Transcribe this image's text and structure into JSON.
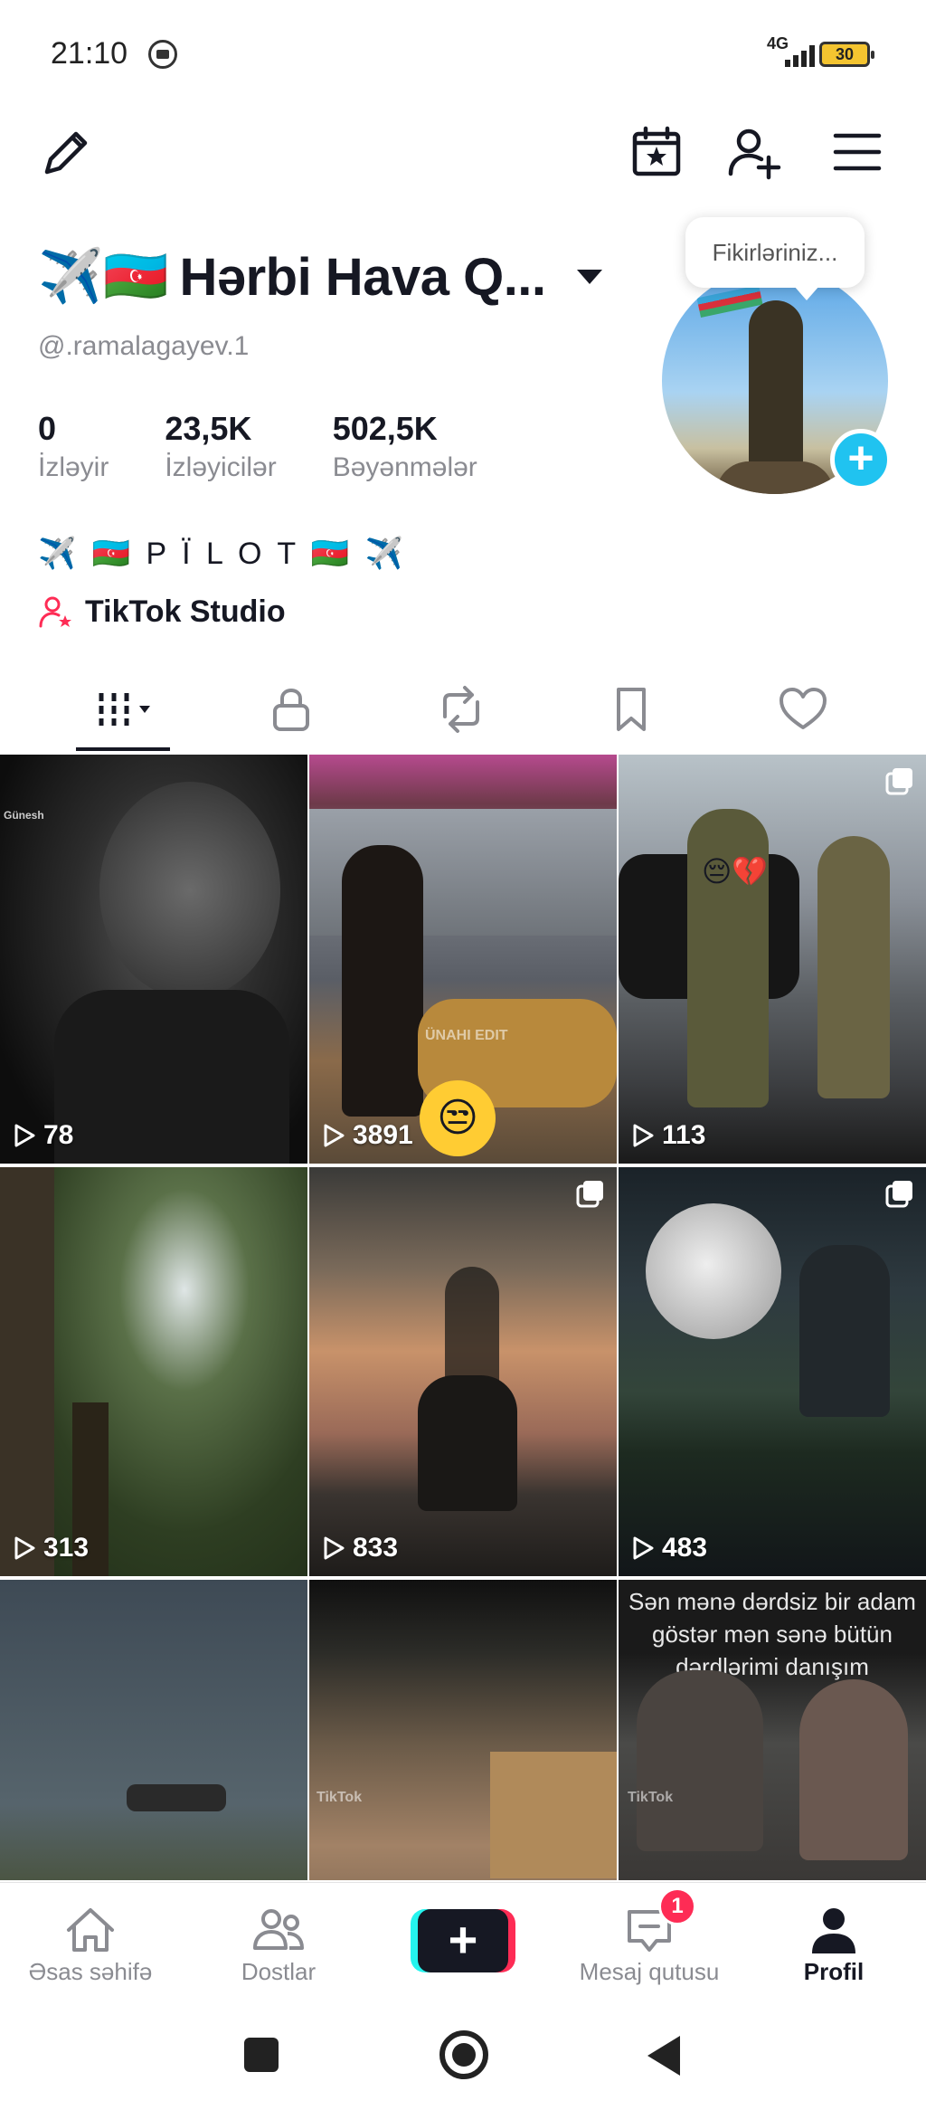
{
  "status_bar": {
    "time": "21:10",
    "network": "4G",
    "battery": "30"
  },
  "profile": {
    "name_emoji": "✈️🇦🇿",
    "name": "Hərbi Hava Q...",
    "handle": "@.ramalagayev.1",
    "note_bubble": "Fikirləriniz...",
    "stats": [
      {
        "value": "0",
        "label": "İzləyir"
      },
      {
        "value": "23,5K",
        "label": "İzləyicilər"
      },
      {
        "value": "502,5K",
        "label": "Bəyənmələr"
      }
    ],
    "bio": "✈️ 🇦🇿 P Ï L O T 🇦🇿 ✈️",
    "studio_link": "TikTok Studio"
  },
  "tabs": [
    {
      "icon": "grid-icon",
      "active": true
    },
    {
      "icon": "lock-icon"
    },
    {
      "icon": "repost-icon"
    },
    {
      "icon": "bookmark-icon"
    },
    {
      "icon": "heart-icon"
    }
  ],
  "videos": [
    {
      "views": "78",
      "multi": false,
      "overlay": ""
    },
    {
      "views": "3891",
      "multi": false,
      "overlay": ""
    },
    {
      "views": "113",
      "multi": true,
      "overlay": ""
    },
    {
      "views": "313",
      "multi": false,
      "overlay": ""
    },
    {
      "views": "833",
      "multi": true,
      "overlay": ""
    },
    {
      "views": "483",
      "multi": true,
      "overlay": ""
    },
    {
      "views": "",
      "multi": false,
      "overlay": ""
    },
    {
      "views": "",
      "multi": false,
      "overlay": ""
    },
    {
      "views": "",
      "multi": false,
      "overlay": "Sən mənə dərdsiz bir adam göstər mən sənə bütün dərdlərimi danışım"
    }
  ],
  "watermarks": {
    "tile1_name": "Günesh",
    "tile2_text": "ÜNAHI EDIT",
    "tiktok": "TikTok"
  },
  "bottom_nav": {
    "home": "Əsas səhifə",
    "friends": "Dostlar",
    "create": "+",
    "inbox": "Mesaj qutusu",
    "inbox_badge": "1",
    "profile": "Profil"
  },
  "colors": {
    "accent": "#fe2c55",
    "cyan": "#25f4ee",
    "avatar_plus": "#20c3f0"
  }
}
